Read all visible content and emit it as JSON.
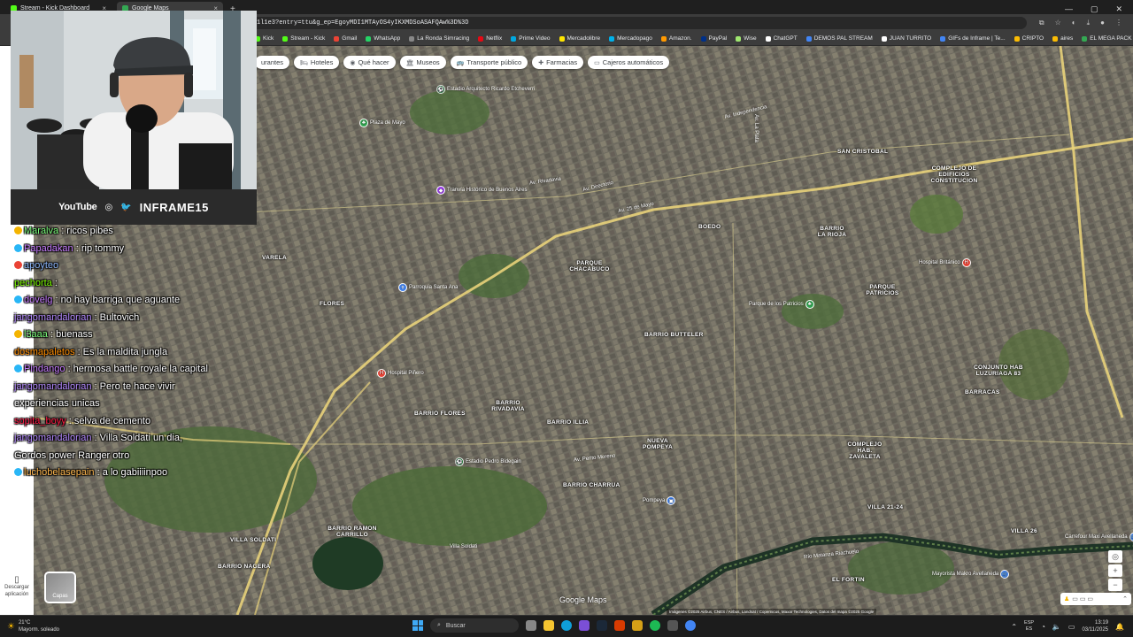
{
  "browser": {
    "tabs": [
      {
        "label": "Stream - Kick Dashboard",
        "color": "#53fc18",
        "active": false
      },
      {
        "label": "Google Maps",
        "color": "#34a853",
        "active": true
      }
    ],
    "new_tab": "+",
    "url": "1l1e3?entry=ttu&g_ep=EgoyMDI1MTAyOS4yIKXMDSoASAFQAw%3D%3D",
    "bookmarks": [
      {
        "label": "Kick",
        "color": "#53fc18"
      },
      {
        "label": "Stream - Kick",
        "color": "#53fc18"
      },
      {
        "label": "Gmail",
        "color": "#ea4335"
      },
      {
        "label": "WhatsApp",
        "color": "#25d366"
      },
      {
        "label": "La Ronda Simracing",
        "color": "#888888"
      },
      {
        "label": "Netflix",
        "color": "#e50914"
      },
      {
        "label": "Prime Video",
        "color": "#00a8e1"
      },
      {
        "label": "Mercadolibre",
        "color": "#ffe600"
      },
      {
        "label": "Mercadopago",
        "color": "#00b1ea"
      },
      {
        "label": "Amazon.",
        "color": "#ff9900"
      },
      {
        "label": "PayPal",
        "color": "#003087"
      },
      {
        "label": "Wise",
        "color": "#9fe870"
      },
      {
        "label": "ChatGPT",
        "color": "#ffffff"
      },
      {
        "label": "DEMOS PAL STREAM",
        "color": "#4285f4"
      },
      {
        "label": "JUAN TURRITO",
        "color": "#ffffff"
      },
      {
        "label": "GIFs de Inframe | Te...",
        "color": "#4285f4"
      },
      {
        "label": "CRIPTO",
        "color": "#fbbc04"
      },
      {
        "label": "aires",
        "color": "#fbbc04"
      },
      {
        "label": "EL MEGA PACK PAP...",
        "color": "#34a853"
      }
    ]
  },
  "map": {
    "chips": [
      {
        "icon": "bed-icon",
        "label": "Hoteles"
      },
      {
        "icon": "camera-icon",
        "label": "Qué hacer"
      },
      {
        "icon": "museum-icon",
        "label": "Museos"
      },
      {
        "icon": "bus-icon",
        "label": "Transporte público"
      },
      {
        "icon": "pharmacy-icon",
        "label": "Farmacias"
      },
      {
        "icon": "atm-icon",
        "label": "Cajeros automáticos"
      }
    ],
    "partial_chip": "urantes",
    "neighborhoods": [
      {
        "label": "SAN CRISTOBAL"
      },
      {
        "label": "BOEDO"
      },
      {
        "label": "PARQUE CHACABUCO"
      },
      {
        "label": "BARRIO LA RIOJA"
      },
      {
        "label": "PARQUE PATRICIOS"
      },
      {
        "label": "FLORES"
      },
      {
        "label": "VARELA"
      },
      {
        "label": "BARRIO BUTTELER"
      },
      {
        "label": "BARRIO RIVADAVIA"
      },
      {
        "label": "BARRIO ILLIA"
      },
      {
        "label": "NUEVA POMPEYA"
      },
      {
        "label": "BARRIO CHARRUA"
      },
      {
        "label": "COMPLEJO HAB. ZAVALETA"
      },
      {
        "label": "BARRACAS"
      },
      {
        "label": "BARRIO RAMON CARRILLO"
      },
      {
        "label": "BARRIO NAGERA"
      },
      {
        "label": "EL FORTIN"
      },
      {
        "label": "VILLA 21-24"
      },
      {
        "label": "VILLA 26"
      },
      {
        "label": "COMPLEJO DE EDIFICIOS CONSTITUCION"
      },
      {
        "label": "CONJUNTO HAB LUZURIAGA 83"
      },
      {
        "label": "VILLA SOLDATI"
      },
      {
        "label": "BARRIO FLORES"
      }
    ],
    "pois": [
      {
        "label": "Estadio Arquitecto Ricardo Etcheverri",
        "color": "#34a853"
      },
      {
        "label": "Tranvía Histórico de Buenos Aires",
        "color": "#a142f4"
      },
      {
        "label": "Plaza de Mayo",
        "color": "#34a853"
      },
      {
        "label": "Parroquia Santa Ana",
        "color": "#4285f4"
      },
      {
        "label": "Parque de los Patricios",
        "color": "#34a853"
      },
      {
        "label": "Hospital Británico",
        "color": "#ea4335"
      },
      {
        "label": "Estadio Pedro Bidegain",
        "color": "#34a853"
      },
      {
        "label": "Hospital Piñero",
        "color": "#ea4335"
      },
      {
        "label": "Carrefour Maxi Avellaneda",
        "color": "#4285f4"
      },
      {
        "label": "Mayorista Makro Avellaneda",
        "color": "#4285f4"
      },
      {
        "label": "Pompeya",
        "color": "#4285f4"
      },
      {
        "label": "Villa Soldati",
        "color": "#4285f4"
      }
    ],
    "streets": [
      "Av. 25 de Mayo",
      "Av. Independencia",
      "Av. Directorio",
      "Av. Rivadavia",
      "Av. Perito Moreno",
      "Av. La Plata"
    ],
    "river_label": "Río Matanza Riachuelo",
    "layers_label": "Capas",
    "logo": "Google Maps",
    "attribution": "Imágenes ©2025 Airbus, CNES / Airbus, Landsat / Copernicus, Maxar Technologies, Datos del mapa ©2025 Google",
    "left_panel": {
      "download_app": "Descargar aplicación"
    }
  },
  "overlay": {
    "social": {
      "youtube": "YouTube",
      "handle": "INFRAME15"
    },
    "chat": [
      {
        "user": "Maralva",
        "text": ": ricos pibes",
        "color": "#7cfc7c",
        "badge": "#f4b400"
      },
      {
        "user": "Papadakan",
        "text": ": rip tommy",
        "color": "#c77dff",
        "badge": "#29b6f6"
      },
      {
        "user": "apoyteo",
        "text": "",
        "color": "#8ab4f8",
        "badge": "#ea4335"
      },
      {
        "user": "pechorta",
        "text": ":",
        "color": "#7cfc00",
        "badge": ""
      },
      {
        "user": "dovelg",
        "text": ": no hay barriga que aguante",
        "color": "#c77dff",
        "badge": "#29b6f6"
      },
      {
        "user": "jangomandalorian",
        "text": ": Bultovich",
        "color": "#b388ff",
        "badge": ""
      },
      {
        "user": "l3aaa",
        "text": ": buenass",
        "color": "#7cfc7c",
        "badge": "#f4b400"
      },
      {
        "user": "dosmapaletos",
        "text": ": Es la maldita jungla",
        "color": "#ff8c00",
        "badge": ""
      },
      {
        "user": "Pindango",
        "text": ": hermosa battle royale la capital",
        "color": "#c77dff",
        "badge": "#29b6f6"
      },
      {
        "user": "jangomandalorian",
        "text": ": Pero te hace vivir experiencias unicas",
        "color": "#b388ff",
        "badge": ""
      },
      {
        "user": "sopita_boyy",
        "text": ": selva de cemento",
        "color": "#ff1744",
        "badge": ""
      },
      {
        "user": "jangomandalorian",
        "text": ": Villa Soldati un dia, Gordos power Ranger otro",
        "color": "#b388ff",
        "badge": ""
      },
      {
        "user": "luchobelasepain",
        "text": ": a lo gabiiiinpoo",
        "color": "#ffb74d",
        "badge": "#29b6f6"
      }
    ]
  },
  "taskbar": {
    "weather_temp": "21°C",
    "weather_desc": "Mayorm. soleado",
    "search_placeholder": "Buscar",
    "lang_top": "ESP",
    "lang_bottom": "ES",
    "time": "13:19",
    "date": "03/11/2025"
  },
  "colors": {
    "map_bg": "#6b6a5f",
    "road": "#e8d27a",
    "taskbar": "#1c1c1c"
  }
}
